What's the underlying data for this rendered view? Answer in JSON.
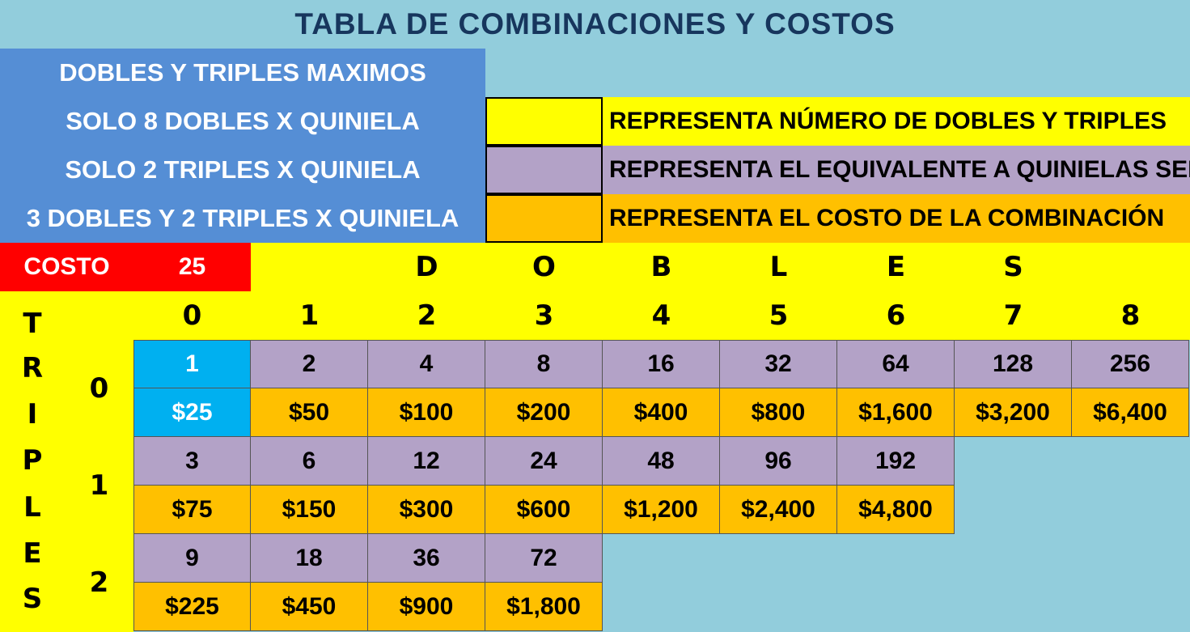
{
  "title": "TABLA DE COMBINACIONES Y COSTOS",
  "rules": [
    "DOBLES Y TRIPLES MAXIMOS",
    "SOLO 8 DOBLES X QUINIELA",
    "SOLO 2 TRIPLES X QUINIELA",
    "3 DOBLES Y 2 TRIPLES X QUINIELA"
  ],
  "legend": [
    {
      "color": "#FFFF00",
      "text": "REPRESENTA NÚMERO DE DOBLES Y TRIPLES"
    },
    {
      "color": "#B3A2C7",
      "text": "REPRESENTA EL EQUIVALENTE A QUINIELAS SENCILLAS"
    },
    {
      "color": "#FFC000",
      "text": "REPRESENTA EL COSTO DE LA COMBINACIÓN"
    }
  ],
  "cost": {
    "label": "COSTO",
    "value": "25"
  },
  "dobles_letters": [
    "D",
    "O",
    "B",
    "L",
    "E",
    "S"
  ],
  "dobles_counts": [
    "0",
    "1",
    "2",
    "3",
    "4",
    "5",
    "6",
    "7",
    "8"
  ],
  "triples_letters": [
    "T",
    "R",
    "I",
    "P",
    "L",
    "E",
    "S"
  ],
  "triples_counts": [
    "0",
    "1",
    "2"
  ],
  "grid": [
    {
      "triples": "0",
      "combos": [
        "1",
        "2",
        "4",
        "8",
        "16",
        "32",
        "64",
        "128",
        "256"
      ],
      "costs": [
        "$25",
        "$50",
        "$100",
        "$200",
        "$400",
        "$800",
        "$1,600",
        "$3,200",
        "$6,400"
      ]
    },
    {
      "triples": "1",
      "combos": [
        "3",
        "6",
        "12",
        "24",
        "48",
        "96",
        "192"
      ],
      "costs": [
        "$75",
        "$150",
        "$300",
        "$600",
        "$1,200",
        "$2,400",
        "$4,800"
      ]
    },
    {
      "triples": "2",
      "combos": [
        "9",
        "18",
        "36",
        "72"
      ],
      "costs": [
        "$225",
        "$450",
        "$900",
        "$1,800"
      ]
    }
  ],
  "colors": {
    "background": "#92CDDC",
    "title": "#17365D",
    "rules_panel": "#558ED5",
    "header_yellow": "#FFFF00",
    "combo_purple": "#B3A2C7",
    "cost_orange": "#FFC000",
    "base_cyan": "#00B0F0",
    "cost_red": "#FF0000"
  }
}
